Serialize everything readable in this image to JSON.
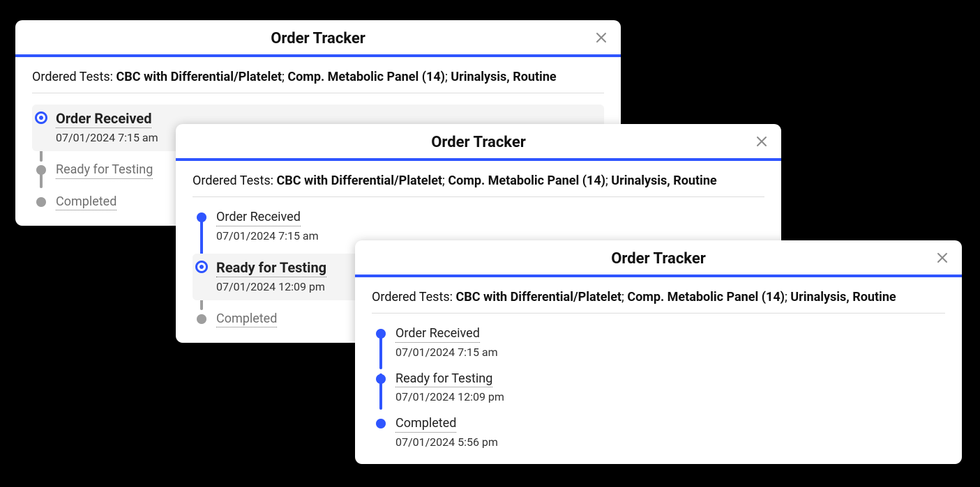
{
  "colors": {
    "accent": "#2f55ff",
    "muted": "#9e9e9e"
  },
  "cards": [
    {
      "title": "Order Tracker",
      "ordered_label": "Ordered Tests: ",
      "tests": [
        "CBC with Differential/Platelet",
        "Comp. Metabolic Panel (14)",
        "Urinalysis, Routine"
      ],
      "steps": [
        {
          "label": "Order Received",
          "ts": "07/01/2024 7:15 am",
          "state": "current"
        },
        {
          "label": "Ready for Testing",
          "ts": null,
          "state": "future"
        },
        {
          "label": "Completed",
          "ts": null,
          "state": "future"
        }
      ]
    },
    {
      "title": "Order Tracker",
      "ordered_label": "Ordered Tests: ",
      "tests": [
        "CBC with Differential/Platelet",
        "Comp. Metabolic Panel (14)",
        "Urinalysis, Routine"
      ],
      "steps": [
        {
          "label": "Order Received",
          "ts": "07/01/2024 7:15 am",
          "state": "done"
        },
        {
          "label": "Ready for Testing",
          "ts": "07/01/2024 12:09 pm",
          "state": "current"
        },
        {
          "label": "Completed",
          "ts": null,
          "state": "future"
        }
      ]
    },
    {
      "title": "Order Tracker",
      "ordered_label": "Ordered Tests: ",
      "tests": [
        "CBC with Differential/Platelet",
        "Comp. Metabolic Panel (14)",
        "Urinalysis, Routine"
      ],
      "steps": [
        {
          "label": "Order Received",
          "ts": "07/01/2024 7:15 am",
          "state": "done"
        },
        {
          "label": "Ready for Testing",
          "ts": "07/01/2024 12:09 pm",
          "state": "done"
        },
        {
          "label": "Completed",
          "ts": "07/01/2024 5:56 pm",
          "state": "done"
        }
      ]
    }
  ]
}
